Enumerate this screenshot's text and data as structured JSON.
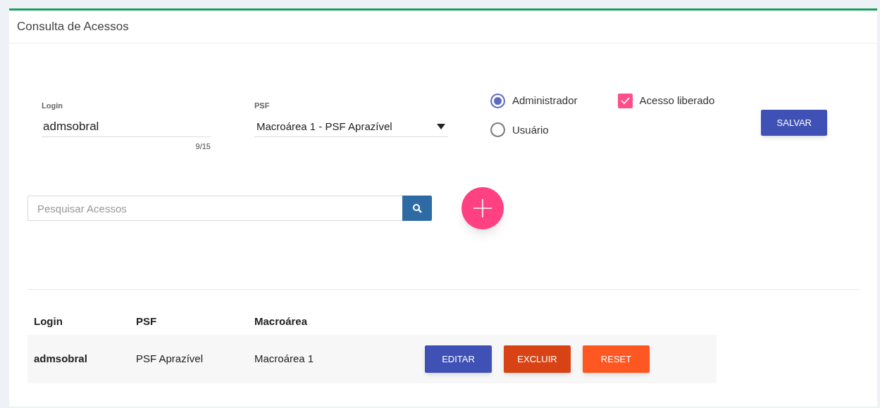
{
  "panel": {
    "title": "Consulta de Acessos"
  },
  "form": {
    "login": {
      "label": "Login",
      "value": "admsobral",
      "counter": "9/15"
    },
    "psf": {
      "label": "PSF",
      "value": "Macroárea 1 - PSF Aprazível"
    },
    "roles": [
      {
        "label": "Administrador",
        "selected": true
      },
      {
        "label": "Usuário",
        "selected": false
      }
    ],
    "access": {
      "label": "Acesso liberado",
      "checked": true
    },
    "save_button": "SALVAR"
  },
  "search": {
    "placeholder": "Pesquisar Acessos"
  },
  "table": {
    "columns": [
      "Login",
      "PSF",
      "Macroárea"
    ],
    "rows": [
      {
        "cells": [
          "admsobral",
          "PSF Aprazível",
          "Macroárea 1"
        ],
        "actions": [
          {
            "label": "EDITAR",
            "color": "#3f51b5"
          },
          {
            "label": "EXCLUIR",
            "color": "#d84315"
          },
          {
            "label": "RESET",
            "color": "#ff5722"
          }
        ]
      }
    ]
  }
}
